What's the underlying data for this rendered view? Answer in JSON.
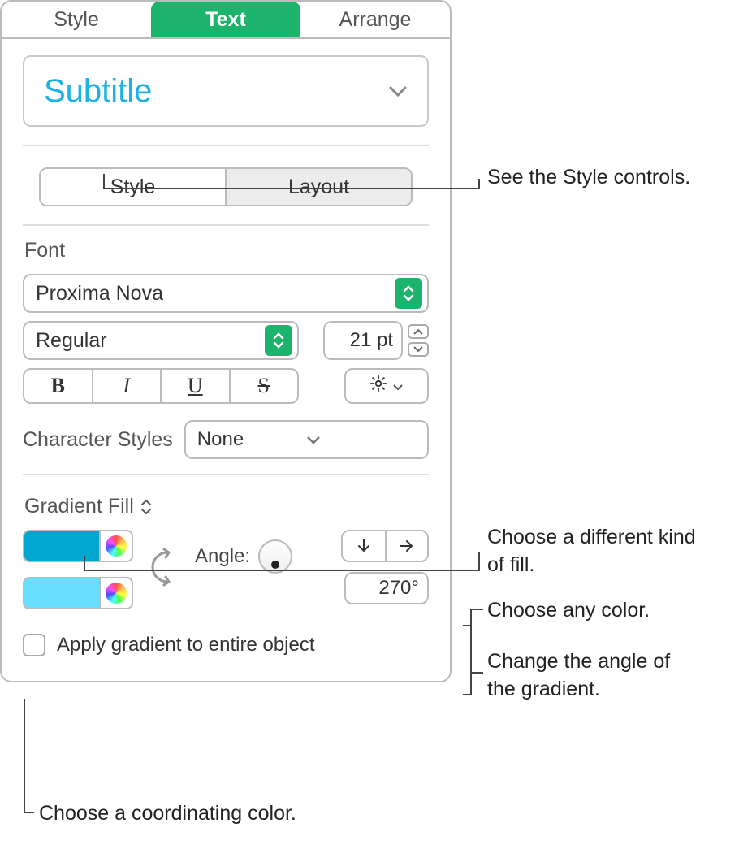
{
  "tabs": {
    "style": "Style",
    "text": "Text",
    "arrange": "Arrange"
  },
  "paragraphStyle": "Subtitle",
  "subtabs": {
    "style": "Style",
    "layout": "Layout"
  },
  "fontSection": "Font",
  "fontFamily": "Proxima Nova",
  "fontWeight": "Regular",
  "fontSize": "21 pt",
  "bius": {
    "b": "B",
    "i": "I",
    "u": "U",
    "s": "S"
  },
  "charStylesLabel": "Character Styles",
  "charStyleValue": "None",
  "fillType": "Gradient Fill",
  "angleLabel": "Angle:",
  "angleValue": "270°",
  "applyGradient": "Apply gradient to entire object",
  "callouts": {
    "styleControls": "See the Style controls.",
    "fillKind": "Choose a different kind of fill.",
    "anyColor": "Choose any color.",
    "angle": "Change the angle of the gradient.",
    "coordColor": "Choose a coordinating color."
  },
  "colors": {
    "stop1": "#00a8cf",
    "stop2": "#68dfff",
    "accent": "#1cb36c"
  }
}
